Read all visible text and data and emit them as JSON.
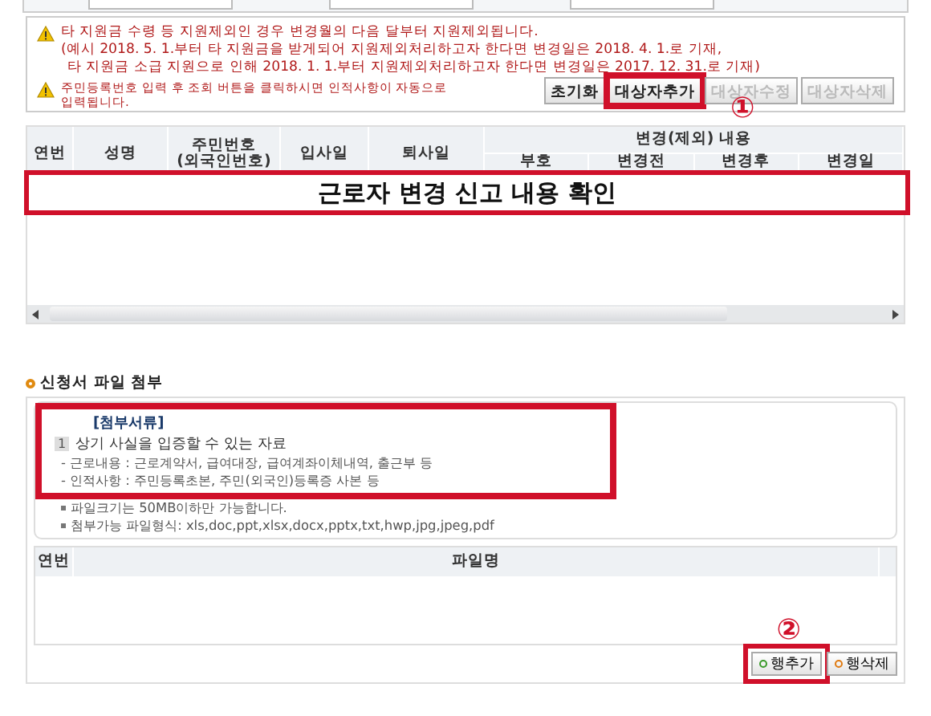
{
  "notice": {
    "items": [
      {
        "lines": [
          "타 지원금 수령 등 지원제외인 경우 변경월의 다음 달부터 지원제외됩니다.",
          "(예시 2018. 5. 1.부터 타 지원금을 받게되어 지원제외처리하고자 한다면 변경일은 2018. 4. 1.로 기재,",
          "타 지원금 소급 지원으로 인해 2018. 1. 1.부터 지원제외처리하고자 한다면 변경일은 2017. 12. 31.로 기재)"
        ]
      },
      {
        "lines": [
          "주민등록번호 입력 후 조회 버튼을 클릭하시면 인적사항이 자동으로",
          "입력됩니다."
        ]
      }
    ],
    "buttons": [
      {
        "label": "초기화",
        "disabled": false,
        "highlighted": false
      },
      {
        "label": "대상자추가",
        "disabled": false,
        "highlighted": true
      },
      {
        "label": "대상자수정",
        "disabled": true,
        "highlighted": false
      },
      {
        "label": "대상자삭제",
        "disabled": true,
        "highlighted": false
      }
    ],
    "marker_1": "①"
  },
  "table": {
    "columns": [
      "연번",
      "성명",
      "주민번호\n(외국인번호)",
      "입사일",
      "퇴사일"
    ],
    "group": {
      "label": "변경(제외) 내용",
      "columns": [
        "부호",
        "변경전",
        "변경후",
        "변경일"
      ]
    },
    "banner": "근로자 변경 신고 내용 확인"
  },
  "attachments": {
    "title": "신청서 파일 첨부",
    "guide": {
      "heading": "[첨부서류]",
      "number": "1",
      "item": "상기 사실을 입증할 수 있는 자료",
      "details": [
        "- 근로내용 : 근로계약서, 급여대장, 급여계좌이체내역, 출근부 등",
        "- 인적사항 : 주민등록초본, 주민(외국인)등록증 사본 등"
      ]
    },
    "notes": [
      "파일크기는 50MB이하만 가능합니다.",
      "첨부가능 파일형식: xls,doc,ppt,xlsx,docx,pptx,txt,hwp,jpg,jpeg,pdf"
    ],
    "columns": [
      "연번",
      "파일명"
    ],
    "marker_2": "②",
    "buttons": [
      {
        "label": "행추가",
        "color": "#3a9a2a",
        "highlighted": true
      },
      {
        "label": "행삭제",
        "color": "#e07a10",
        "highlighted": false
      }
    ]
  }
}
